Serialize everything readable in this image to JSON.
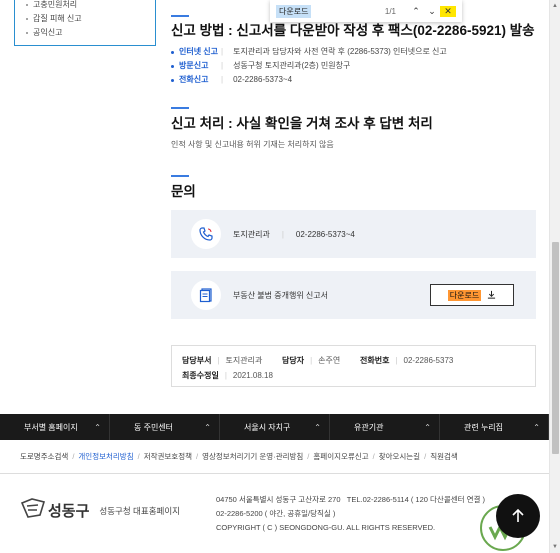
{
  "sidebar": {
    "items": [
      "고충민원처리",
      "갑질 피해 신고",
      "공익신고"
    ]
  },
  "findbar": {
    "query": "다운로드",
    "count": "1/1",
    "prev": "▲",
    "next": "▼",
    "close": "✕"
  },
  "method": {
    "title_pre": "신고 방법 : 신고서를 ",
    "title_hidden": "다운받아 작성 후 팩스",
    "title_post": "(02-2286-5921) 발송",
    "items": [
      {
        "label": "인터넷 신고",
        "value": "토지관리과 담당자와 사전 연락 후 (2286-5373) 인터넷으로 신고"
      },
      {
        "label": "방문신고",
        "value": "성동구청 토지관리과(2층) 민원창구"
      },
      {
        "label": "전화신고",
        "value": "02-2286-5373~4"
      }
    ]
  },
  "process": {
    "title": "신고 처리 : 사실 확인을 거쳐 조사 후 답변 처리",
    "note": "인적 사항 및 신고내용 허위 기재는 처리하지 않음"
  },
  "contact": {
    "title": "문의",
    "dept": "토지관리과",
    "phone": "02-2286-5373~4",
    "form_name": "부동산 불법 중개행위 신고서",
    "download_label": "다운로드"
  },
  "info": {
    "dept_label": "담당부서",
    "dept": "토지관리과",
    "person_label": "담당자",
    "person": "손주연",
    "tel_label": "전화번호",
    "tel": "02-2286-5373",
    "updated_label": "최종수정일",
    "updated": "2021.08.18"
  },
  "footer_nav": [
    "부서별 홈페이지",
    "동 주민센터",
    "서울시 자치구",
    "유관기관",
    "관련 누리집"
  ],
  "footer_links": [
    "도로명주소검색",
    "개인정보처리방침",
    "저작권보호정책",
    "영상정보처리기기 운영·관리방침",
    "홈페이지오류신고",
    "찾아오시는길",
    "직원검색"
  ],
  "footer": {
    "logo_text": "성동구",
    "site_name": "성동구청 대표홈페이지",
    "address": "04750 서울특별시 성동구 고산자로 270",
    "tel": "TEL.02-2286-5114 ( 120 다산콜센터 연결 )",
    "night": "02-2286-5200 ( 야간, 공휴일/당직실 )",
    "copyright": "COPYRIGHT ( C ) SEONGDONG-GU. ALL RIGHTS RESERVED."
  },
  "colors": {
    "accent": "#1f5fd0",
    "footer_bg": "#1a1a1a",
    "card_bg": "#eef1f6",
    "find_highlight": "#ff9632"
  }
}
